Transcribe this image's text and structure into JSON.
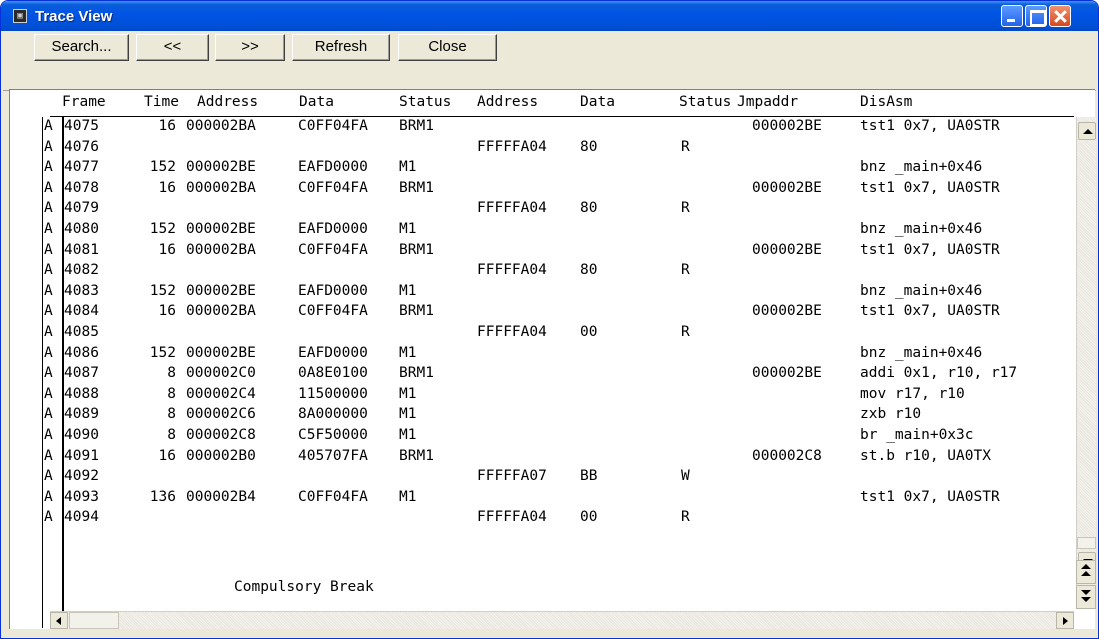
{
  "window": {
    "title": "Trace View",
    "icon": "trace-window-icon"
  },
  "toolbar": {
    "search": "Search...",
    "prev": "<<",
    "next": ">>",
    "refresh": "Refresh",
    "close": "Close"
  },
  "columns": {
    "frame": "Frame",
    "time": "Time",
    "address1": "Address",
    "data1": "Data",
    "status1": "Status",
    "address2": "Address",
    "data2": "Data",
    "status2": "Status",
    "jmpaddr": "Jmpaddr",
    "disasm": "DisAsm"
  },
  "rows": [
    {
      "mark": "A",
      "frame": "4075",
      "time": "16",
      "addr1": "000002BA",
      "data1": "C0FF04FA",
      "status1": "BRM1",
      "addr2": "",
      "data2": "",
      "status2": "",
      "jmp": "000002BE",
      "dis": "tst1 0x7, UA0STR"
    },
    {
      "mark": "A",
      "frame": "4076",
      "time": "",
      "addr1": "",
      "data1": "",
      "status1": "",
      "addr2": "FFFFFA04",
      "data2": "80",
      "status2": "R",
      "jmp": "",
      "dis": ""
    },
    {
      "mark": "A",
      "frame": "4077",
      "time": "152",
      "addr1": "000002BE",
      "data1": "EAFD0000",
      "status1": "M1",
      "addr2": "",
      "data2": "",
      "status2": "",
      "jmp": "",
      "dis": "bnz _main+0x46"
    },
    {
      "mark": "A",
      "frame": "4078",
      "time": "16",
      "addr1": "000002BA",
      "data1": "C0FF04FA",
      "status1": "BRM1",
      "addr2": "",
      "data2": "",
      "status2": "",
      "jmp": "000002BE",
      "dis": "tst1 0x7, UA0STR"
    },
    {
      "mark": "A",
      "frame": "4079",
      "time": "",
      "addr1": "",
      "data1": "",
      "status1": "",
      "addr2": "FFFFFA04",
      "data2": "80",
      "status2": "R",
      "jmp": "",
      "dis": ""
    },
    {
      "mark": "A",
      "frame": "4080",
      "time": "152",
      "addr1": "000002BE",
      "data1": "EAFD0000",
      "status1": "M1",
      "addr2": "",
      "data2": "",
      "status2": "",
      "jmp": "",
      "dis": "bnz _main+0x46"
    },
    {
      "mark": "A",
      "frame": "4081",
      "time": "16",
      "addr1": "000002BA",
      "data1": "C0FF04FA",
      "status1": "BRM1",
      "addr2": "",
      "data2": "",
      "status2": "",
      "jmp": "000002BE",
      "dis": "tst1 0x7, UA0STR"
    },
    {
      "mark": "A",
      "frame": "4082",
      "time": "",
      "addr1": "",
      "data1": "",
      "status1": "",
      "addr2": "FFFFFA04",
      "data2": "80",
      "status2": "R",
      "jmp": "",
      "dis": ""
    },
    {
      "mark": "A",
      "frame": "4083",
      "time": "152",
      "addr1": "000002BE",
      "data1": "EAFD0000",
      "status1": "M1",
      "addr2": "",
      "data2": "",
      "status2": "",
      "jmp": "",
      "dis": "bnz _main+0x46"
    },
    {
      "mark": "A",
      "frame": "4084",
      "time": "16",
      "addr1": "000002BA",
      "data1": "C0FF04FA",
      "status1": "BRM1",
      "addr2": "",
      "data2": "",
      "status2": "",
      "jmp": "000002BE",
      "dis": "tst1 0x7, UA0STR"
    },
    {
      "mark": "A",
      "frame": "4085",
      "time": "",
      "addr1": "",
      "data1": "",
      "status1": "",
      "addr2": "FFFFFA04",
      "data2": "00",
      "status2": "R",
      "jmp": "",
      "dis": ""
    },
    {
      "mark": "A",
      "frame": "4086",
      "time": "152",
      "addr1": "000002BE",
      "data1": "EAFD0000",
      "status1": "M1",
      "addr2": "",
      "data2": "",
      "status2": "",
      "jmp": "",
      "dis": "bnz _main+0x46"
    },
    {
      "mark": "A",
      "frame": "4087",
      "time": "8",
      "addr1": "000002C0",
      "data1": "0A8E0100",
      "status1": "BRM1",
      "addr2": "",
      "data2": "",
      "status2": "",
      "jmp": "000002BE",
      "dis": "addi 0x1, r10, r17"
    },
    {
      "mark": "A",
      "frame": "4088",
      "time": "8",
      "addr1": "000002C4",
      "data1": "11500000",
      "status1": "M1",
      "addr2": "",
      "data2": "",
      "status2": "",
      "jmp": "",
      "dis": "mov r17, r10"
    },
    {
      "mark": "A",
      "frame": "4089",
      "time": "8",
      "addr1": "000002C6",
      "data1": "8A000000",
      "status1": "M1",
      "addr2": "",
      "data2": "",
      "status2": "",
      "jmp": "",
      "dis": "zxb r10"
    },
    {
      "mark": "A",
      "frame": "4090",
      "time": "8",
      "addr1": "000002C8",
      "data1": "C5F50000",
      "status1": "M1",
      "addr2": "",
      "data2": "",
      "status2": "",
      "jmp": "",
      "dis": "br _main+0x3c"
    },
    {
      "mark": "A",
      "frame": "4091",
      "time": "16",
      "addr1": "000002B0",
      "data1": "405707FA",
      "status1": "BRM1",
      "addr2": "",
      "data2": "",
      "status2": "",
      "jmp": "000002C8",
      "dis": "st.b r10, UA0TX"
    },
    {
      "mark": "A",
      "frame": "4092",
      "time": "",
      "addr1": "",
      "data1": "",
      "status1": "",
      "addr2": "FFFFFA07",
      "data2": "BB",
      "status2": "W",
      "jmp": "",
      "dis": ""
    },
    {
      "mark": "A",
      "frame": "4093",
      "time": "136",
      "addr1": "000002B4",
      "data1": "C0FF04FA",
      "status1": "M1",
      "addr2": "",
      "data2": "",
      "status2": "",
      "jmp": "",
      "dis": "tst1 0x7, UA0STR"
    },
    {
      "mark": "A",
      "frame": "4094",
      "time": "",
      "addr1": "",
      "data1": "",
      "status1": "",
      "addr2": "FFFFFA04",
      "data2": "00",
      "status2": "R",
      "jmp": "",
      "dis": ""
    }
  ],
  "footer_message": "Compulsory Break"
}
